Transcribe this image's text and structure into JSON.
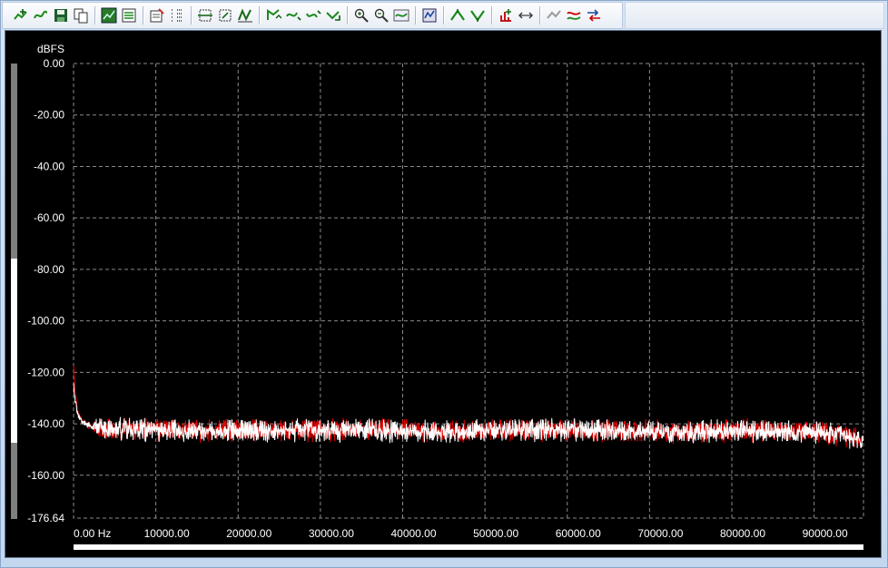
{
  "toolbar": {
    "groups": [
      [
        "add-trace-icon",
        "smooth-trace-icon",
        "save-icon",
        "copy-icon"
      ],
      [
        "graph-view-icon",
        "graph-settings-icon"
      ],
      [
        "edit-table-icon",
        "data-table-icon"
      ],
      [
        "zoom-x-icon",
        "zoom-xy-icon",
        "auto-scale-icon"
      ],
      [
        "scale-up-icon",
        "scale-left-icon",
        "scale-down-icon",
        "scale-right-icon"
      ],
      [
        "zoom-in-icon",
        "zoom-out-icon",
        "fit-trace-icon"
      ],
      [
        "print-preview-icon"
      ],
      [
        "peak-up-icon",
        "peak-down-icon"
      ],
      [
        "marker-add-icon",
        "marker-move-icon"
      ],
      [
        "cursor-disabled-icon",
        "overlay-icon",
        "swap-icon"
      ]
    ]
  },
  "chart_data": {
    "type": "line",
    "ylabel": "dBFS",
    "xlabel": "",
    "xlim": [
      0,
      96000
    ],
    "ylim": [
      -176.64,
      0
    ],
    "x_ticks": [
      0,
      10000,
      20000,
      30000,
      40000,
      50000,
      60000,
      70000,
      80000,
      90000
    ],
    "x_tick_labels": [
      "0.00 Hz",
      "10000.00",
      "20000.00",
      "30000.00",
      "40000.00",
      "50000.00",
      "60000.00",
      "70000.00",
      "80000.00",
      "90000.00"
    ],
    "y_ticks": [
      0,
      -20,
      -40,
      -60,
      -80,
      -100,
      -120,
      -140,
      -160,
      -176.64
    ],
    "y_tick_labels": [
      "0.00",
      "-20.00",
      "-40.00",
      "-60.00",
      "-80.00",
      "-100.00",
      "-120.00",
      "-140.00",
      "-160.00",
      "-176.64"
    ],
    "grid": true,
    "series": [
      {
        "color": "#e00000",
        "x": [
          0,
          200,
          500,
          1000,
          2000,
          3000,
          5000,
          10000,
          15000,
          20000,
          25000,
          30000,
          35000,
          40000,
          45000,
          50000,
          55000,
          60000,
          65000,
          70000,
          75000,
          80000,
          85000,
          90000,
          93000,
          96000
        ],
        "y": [
          -117,
          -128,
          -135,
          -139,
          -141,
          -142,
          -142,
          -142,
          -142.5,
          -142.5,
          -142.5,
          -142.5,
          -142.5,
          -142.5,
          -143,
          -142.5,
          -142.5,
          -142.5,
          -142.5,
          -143,
          -143,
          -142.5,
          -142.5,
          -143,
          -144,
          -146
        ]
      },
      {
        "color": "#ffffff",
        "x": [
          0,
          200,
          500,
          1000,
          2000,
          3000,
          5000,
          10000,
          15000,
          20000,
          25000,
          30000,
          35000,
          40000,
          45000,
          50000,
          55000,
          60000,
          65000,
          70000,
          75000,
          80000,
          85000,
          90000,
          93000,
          96000
        ],
        "y": [
          -125,
          -131,
          -136,
          -139,
          -141,
          -142,
          -142,
          -142.5,
          -142.5,
          -142.5,
          -142.5,
          -142.5,
          -142.5,
          -143,
          -143,
          -142.5,
          -142.5,
          -142.5,
          -143,
          -143,
          -143,
          -142.5,
          -143,
          -143.5,
          -144.5,
          -147
        ]
      }
    ]
  }
}
